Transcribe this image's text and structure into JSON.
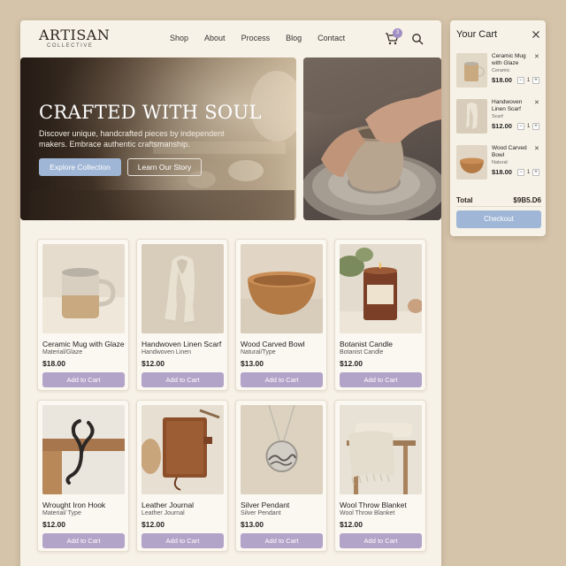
{
  "brand": {
    "name": "ARTISAN",
    "tagline": "COLLECTIVE"
  },
  "nav": {
    "links": [
      "Shop",
      "About",
      "Process",
      "Blog",
      "Contact"
    ],
    "cart_count": "3"
  },
  "hero": {
    "title": "CRAFTED WITH SOUL",
    "subtitle": "Discover unique, handcrafted pieces by independent makers. Embrace authentic craftsmanship.",
    "primary_cta": "Explore Collection",
    "secondary_cta": "Learn Our Story"
  },
  "products": [
    {
      "name": "Ceramic Mug with Glaze",
      "material": "Material/Glaze",
      "price": "$18.00",
      "cta": "Add to Cart"
    },
    {
      "name": "Handwoven Linen Scarf",
      "material": "Handwoven Linen",
      "price": "$12.00",
      "cta": "Add to Cart"
    },
    {
      "name": "Wood Carved Bowl",
      "material": "Natural/Type",
      "price": "$13.00",
      "cta": "Add to Cart"
    },
    {
      "name": "Botanist Candle",
      "material": "Botanist Candle",
      "price": "$12.00",
      "cta": "Add to Cart"
    },
    {
      "name": "Wrought Iron Hook",
      "material": "Material/ Type",
      "price": "$12.00",
      "cta": "Add to Cart"
    },
    {
      "name": "Leather Journal",
      "material": "Leather Journal",
      "price": "$12.00",
      "cta": "Add to Cart"
    },
    {
      "name": "Silver Pendant",
      "material": "Silver Pendant",
      "price": "$13.00",
      "cta": "Add to Cart"
    },
    {
      "name": "Wool Throw Blanket",
      "material": "Wool Throw Blanket",
      "price": "$12.00",
      "cta": "Add to Cart"
    }
  ],
  "cart": {
    "title": "Your Cart",
    "items": [
      {
        "name": "Ceramic Mug with Glaze",
        "desc": "Ceramic",
        "price": "$18.00",
        "qty": "1"
      },
      {
        "name": "Handwoven Linen Scarf",
        "desc": "Scarf",
        "price": "$12.00",
        "qty": "1"
      },
      {
        "name": "Wood Carved Bowl",
        "desc": "Natural",
        "price": "$18.00",
        "qty": "1"
      }
    ],
    "total_label": "Total",
    "total_value": "$9B5.D6",
    "checkout_label": "Checkout"
  },
  "colors": {
    "background": "#d5c4aa",
    "panel": "#f7f2e7",
    "accent_blue": "#9fb6d6",
    "accent_lavender": "#b2a3c8",
    "badge": "#a18fc4"
  },
  "icons": [
    "cart-icon",
    "search-icon",
    "close-icon",
    "minus-icon",
    "plus-icon"
  ]
}
